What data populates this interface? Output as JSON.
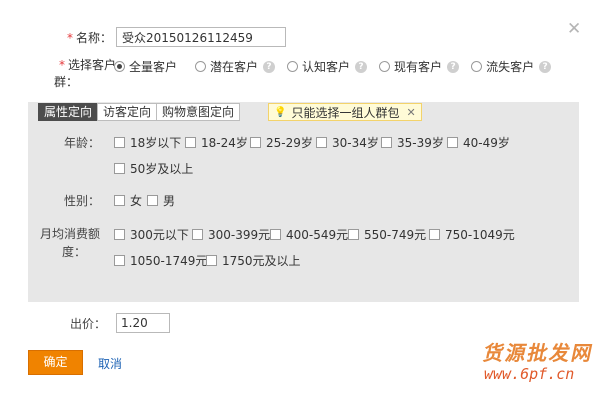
{
  "close_icon": "close-icon",
  "name_field": {
    "label": "名称：",
    "value": "受众20150126112459"
  },
  "audience": {
    "label_line1": "选择客户",
    "label_line2": "群：",
    "options": [
      "全量客户",
      "潜在客户",
      "认知客户",
      "现有客户",
      "流失客户"
    ],
    "selected": "全量客户"
  },
  "targeting": {
    "tabs": [
      "属性定向",
      "访客定向",
      "购物意图定向"
    ],
    "active_tab": "属性定向",
    "tip": "只能选择一组人群包",
    "age": {
      "label": "年龄：",
      "options": [
        "18岁以下",
        "18-24岁",
        "25-29岁",
        "30-34岁",
        "35-39岁",
        "40-49岁",
        "50岁及以上"
      ]
    },
    "gender": {
      "label": "性别：",
      "options": [
        "女",
        "男"
      ]
    },
    "spend": {
      "label_line1": "月均消费额",
      "label_line2": "度：",
      "options": [
        "300元以下",
        "300-399元",
        "400-549元",
        "550-749元",
        "750-1049元",
        "1050-1749元",
        "1750元及以上"
      ]
    }
  },
  "price": {
    "label": "出价：",
    "value": "1.20"
  },
  "buttons": {
    "ok": "确定",
    "cancel": "取消"
  },
  "watermark": {
    "line1": "货源批发网",
    "line2": "www.6pf.cn"
  },
  "colors": {
    "primary_button": "#f08300",
    "link": "#1e63b5",
    "required": "#e4393c",
    "active_tab": "#4d4d4d",
    "panel_bg": "#e7e7e7"
  }
}
